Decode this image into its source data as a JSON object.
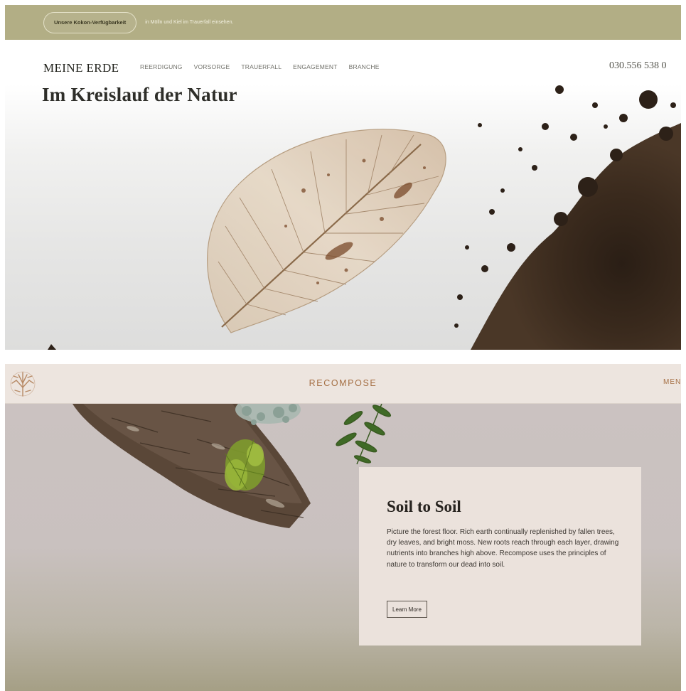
{
  "meine_erde": {
    "announcement": {
      "pill_label": "Unsere Kokon-Verfügbarkeit",
      "text": "in Mölln und Kiel im Trauerfall einsehen."
    },
    "logo": "MEINE ERDE",
    "nav_items": [
      "REERDIGUNG",
      "VORSORGE",
      "TRAUERFALL",
      "ENGAGEMENT",
      "BRANCHE"
    ],
    "phone": "030.556 538 0",
    "headline": "Im Kreislauf der Natur"
  },
  "recompose": {
    "brand": "RECOMPOSE",
    "menu_label": "MEN",
    "card": {
      "title": "Soil to Soil",
      "text": "Picture the forest floor. Rich earth continually replenished by fallen trees, dry leaves, and bright moss. New roots reach through each layer, drawing nutrients into branches high above. Recompose uses the principles of nature to transform our dead into soil.",
      "button_label": "Learn More"
    }
  },
  "colors": {
    "announcement_bar": "#b2ae85",
    "recompose_accent": "#a56f44",
    "recompose_background": "#ccc3c3",
    "card_background": "#ebe2dc"
  }
}
